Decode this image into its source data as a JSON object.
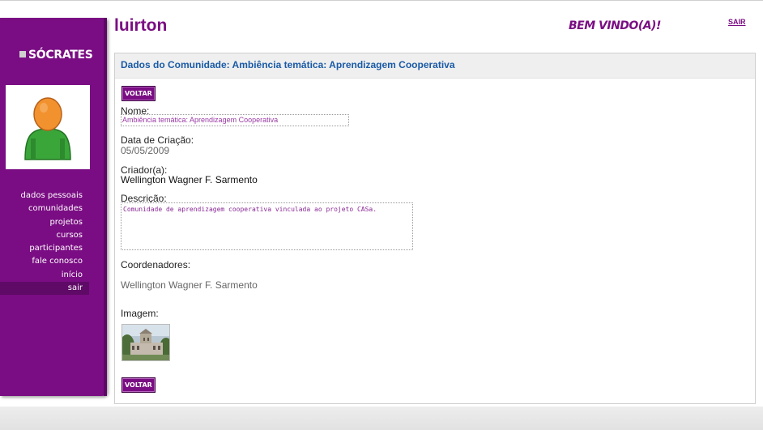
{
  "app": {
    "logo": "SÓCRATES",
    "user_name": "luirton",
    "welcome": "BEM VINDO(A)!",
    "logout_top": "SAIR"
  },
  "sidebar": {
    "items": [
      {
        "label": "dados pessoais"
      },
      {
        "label": "comunidades"
      },
      {
        "label": "projetos"
      },
      {
        "label": "cursos"
      },
      {
        "label": "participantes"
      },
      {
        "label": "fale conosco"
      },
      {
        "label": "início"
      },
      {
        "label": "sair"
      }
    ]
  },
  "panel": {
    "title": "Dados do Comunidade: Ambiência temática: Aprendizagem Cooperativa",
    "back_label": "VOLTAR",
    "name_label": "Nome:",
    "name_value": "Ambiência temática: Aprendizagem Cooperativa",
    "created_label": "Data de Criação:",
    "created_value": "05/05/2009",
    "creator_label": "Criador(a):",
    "creator_value": "Wellington Wagner F. Sarmento",
    "description_label": "Descrição:",
    "description_value": "Comunidade de aprendizagem cooperativa vinculada ao projeto CASa.",
    "coordinators_label": "Coordenadores:",
    "coordinators_value": "Wellington Wagner F. Sarmento",
    "image_label": "Imagem:"
  },
  "colors": {
    "brand_purple": "#7a0d83",
    "title_blue": "#1a5aa6"
  },
  "icons": {
    "avatar": "user-avatar-icon",
    "logo_mark": "square-bullet-icon"
  }
}
